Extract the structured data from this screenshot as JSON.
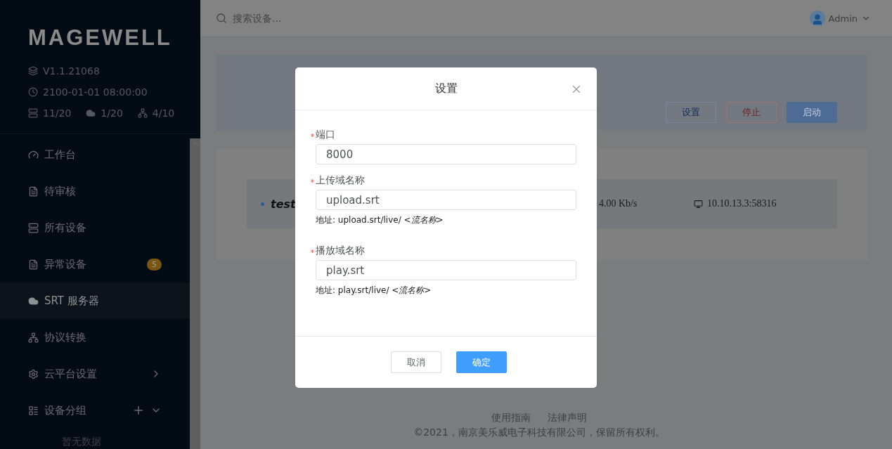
{
  "sidebar": {
    "logo": "MAGEWELL",
    "version": "V1.1.21068",
    "time": "2100-01-01 08:00:00",
    "stats": [
      {
        "kind": "server",
        "value": "11/20"
      },
      {
        "kind": "cloud",
        "value": "1/20"
      },
      {
        "kind": "network",
        "value": "4/10"
      }
    ],
    "nav": [
      {
        "kind": "link",
        "label": "工作台",
        "selected": false
      },
      {
        "kind": "link",
        "label": "待审核",
        "selected": false
      },
      {
        "kind": "link",
        "label": "所有设备",
        "selected": false
      },
      {
        "kind": "link",
        "label": "异常设备",
        "selected": false,
        "badge": "5"
      },
      {
        "kind": "link",
        "label": "SRT 服务器",
        "selected": true
      },
      {
        "kind": "link",
        "label": "协议转换",
        "selected": false
      },
      {
        "kind": "submenu",
        "label": "云平台设置",
        "selected": false
      },
      {
        "kind": "group",
        "label": "设备分组",
        "selected": false
      }
    ],
    "empty_text": "暂无数据"
  },
  "topbar": {
    "search_placeholder": "搜索设备...",
    "user": "Admin"
  },
  "server_card": {
    "buttons": [
      {
        "kind": "outline-blue",
        "label": "设置"
      },
      {
        "kind": "outline-red",
        "label": "停止"
      },
      {
        "kind": "filled",
        "label": "启动"
      }
    ]
  },
  "stream_row": {
    "name": "test",
    "bitrate": "4.00 Kb/s",
    "address": "10.10.13.3:58316"
  },
  "dialog": {
    "title": "设置",
    "fields": [
      {
        "label": "端口",
        "required": true,
        "value": "8000"
      },
      {
        "label": "上传域名称",
        "required": true,
        "value": "upload.srt",
        "hint": "地址: upload.srt/live/ *<流名称>*"
      },
      {
        "label": "播放域名称",
        "required": true,
        "value": "play.srt",
        "hint": "地址: play.srt/live/ *<流名称>*"
      }
    ],
    "buttons": [
      {
        "kind": "default",
        "label": "取消"
      },
      {
        "kind": "primary",
        "label": "确定"
      }
    ]
  },
  "footer": {
    "links": [
      "使用指南",
      "法律声明"
    ],
    "copyright": "©2021，南京美乐威电子科技有限公司，保留所有权利。"
  }
}
